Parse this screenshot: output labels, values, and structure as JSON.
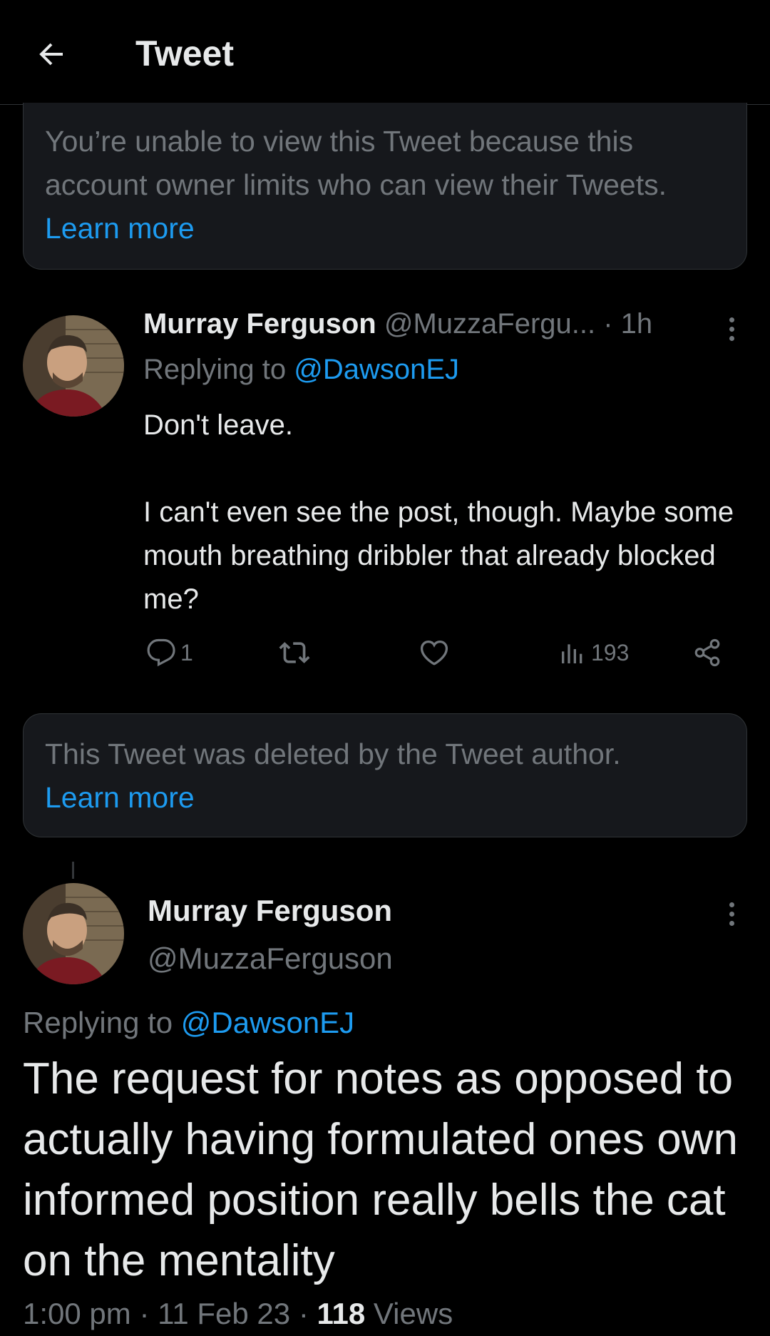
{
  "header": {
    "title": "Tweet",
    "back_icon": "arrow-left-icon"
  },
  "notice_protected": {
    "text": "You’re unable to view this Tweet because this account owner limits who can view their Tweets.",
    "link": "Learn more"
  },
  "reply_tweet": {
    "author_name": "Murray Ferguson",
    "author_handle": "@MuzzaFergu...",
    "separator": "·",
    "time": "1h",
    "replying_label": "Replying to",
    "replying_to": "@DawsonEJ",
    "body_lines": [
      "Don't leave.",
      "",
      "I can't even see the post, though. Maybe some mouth breathing dribbler that already blocked me?"
    ],
    "reply_count": "1",
    "retweet_count": "",
    "like_count": "",
    "view_count": "193"
  },
  "notice_deleted": {
    "text": "This Tweet was deleted by the Tweet author.",
    "link": "Learn more"
  },
  "main_tweet": {
    "author_name": "Murray Ferguson",
    "author_handle": "@MuzzaFerguson",
    "replying_label": "Replying to",
    "replying_to": "@DawsonEJ",
    "body": "The request for notes as opposed to actually having formulated ones own informed position really bells the cat on the mentality",
    "time": "1:00 pm",
    "sep1": "·",
    "date": "11 Feb 23",
    "sep2": "·",
    "views_count": "118",
    "views_label": "Views"
  },
  "colors": {
    "background": "#000000",
    "accent": "#1d9bf0",
    "muted": "#71767b",
    "text": "#e7e9ea",
    "card": "#16181c"
  }
}
